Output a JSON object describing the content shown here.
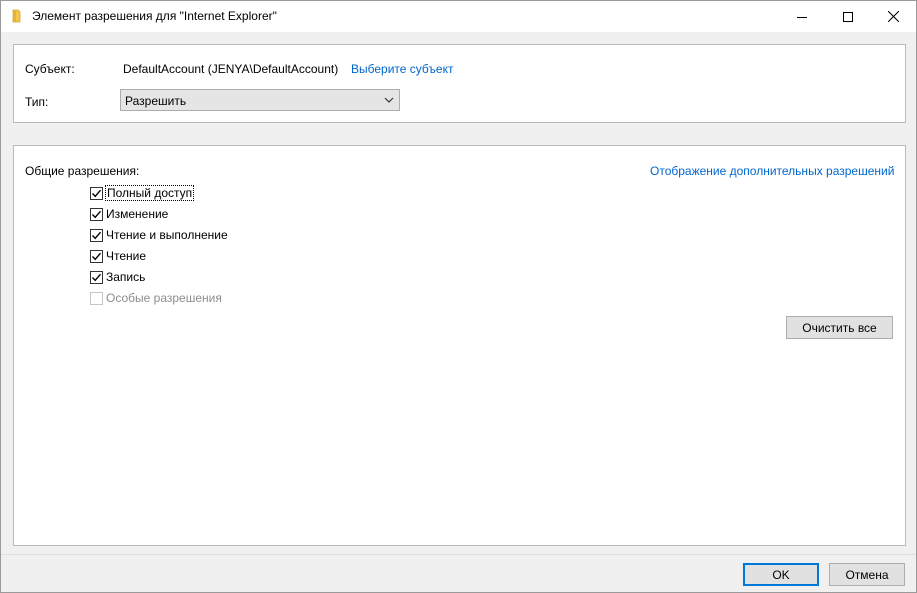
{
  "window": {
    "title": "Элемент разрешения для \"Internet Explorer\""
  },
  "principal": {
    "label": "Субъект:",
    "value": "DefaultAccount (JENYA\\DefaultAccount)",
    "select_link": "Выберите субъект"
  },
  "type": {
    "label": "Тип:",
    "selected": "Разрешить"
  },
  "permissions": {
    "header": "Общие разрешения:",
    "advanced_link": "Отображение дополнительных разрешений",
    "items": [
      {
        "label": "Полный доступ",
        "checked": true,
        "enabled": true
      },
      {
        "label": "Изменение",
        "checked": true,
        "enabled": true
      },
      {
        "label": "Чтение и выполнение",
        "checked": true,
        "enabled": true
      },
      {
        "label": "Чтение",
        "checked": true,
        "enabled": true
      },
      {
        "label": "Запись",
        "checked": true,
        "enabled": true
      },
      {
        "label": "Особые разрешения",
        "checked": false,
        "enabled": false
      }
    ],
    "clear_all": "Очистить все"
  },
  "footer": {
    "ok": "OK",
    "cancel": "Отмена"
  }
}
